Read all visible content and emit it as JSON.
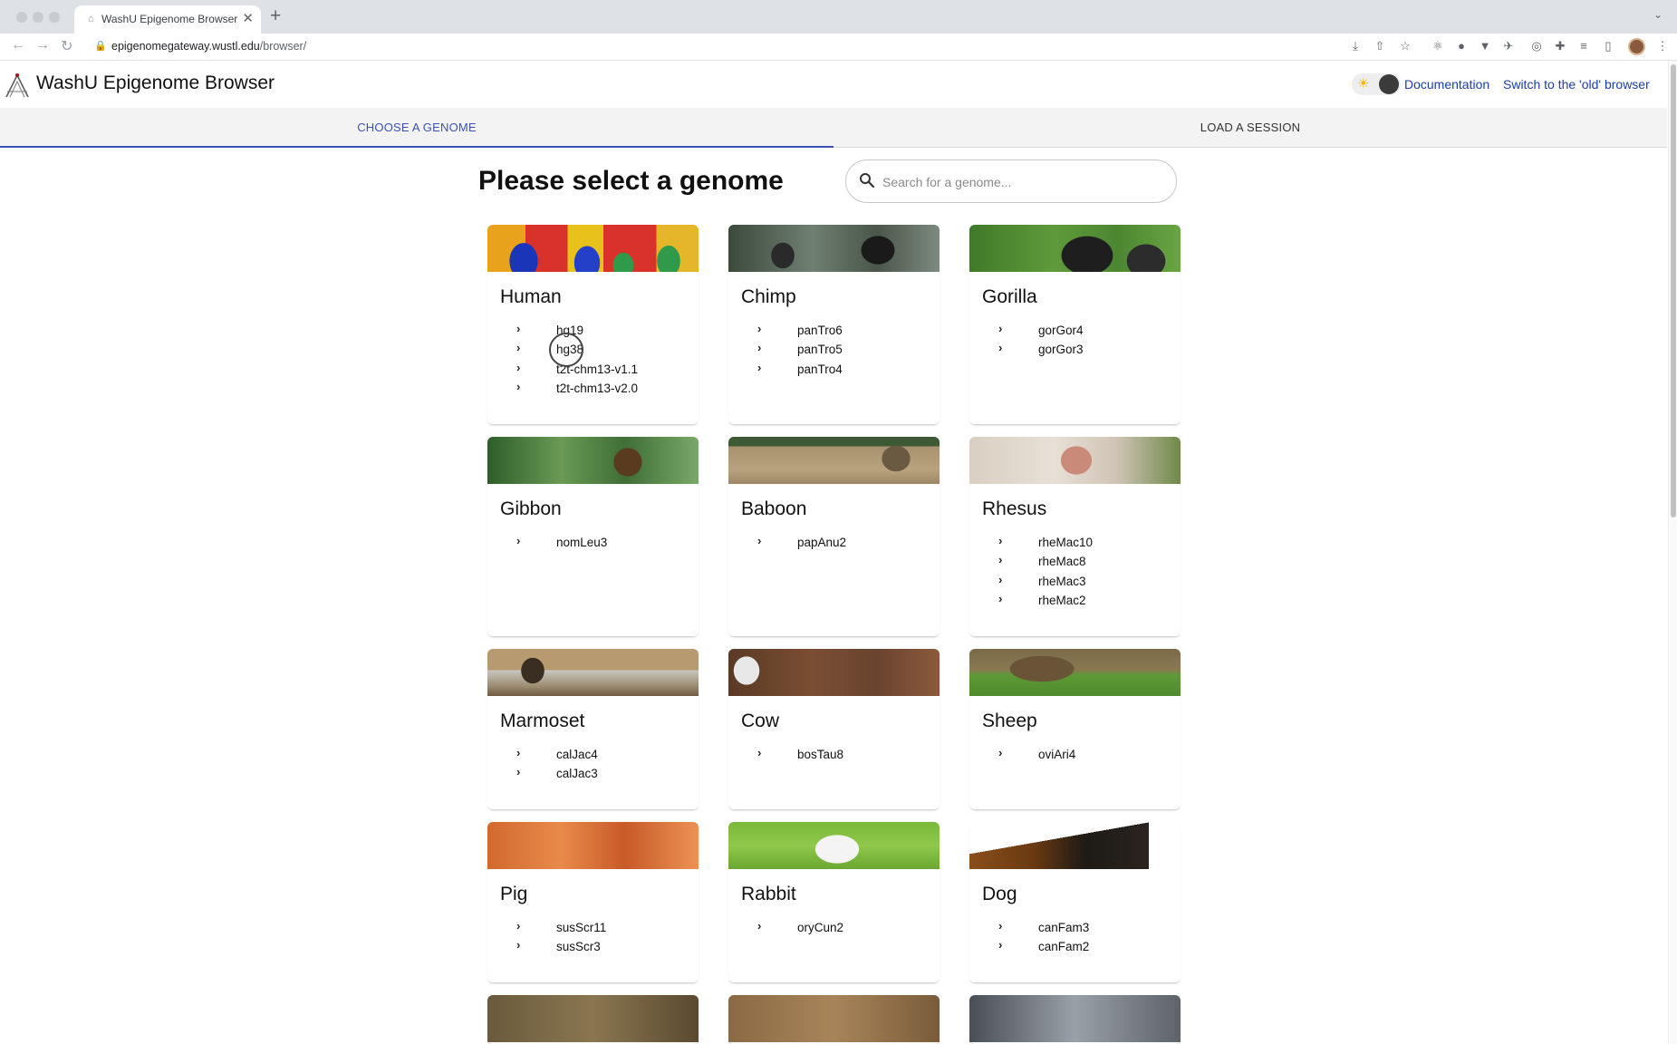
{
  "browser": {
    "tab_title": "WashU Epigenome Browser",
    "url_host": "epigenomegateway.wustl.edu",
    "url_path": "/browser/"
  },
  "app": {
    "title": "WashU Epigenome Browser",
    "documentation_link": "Documentation",
    "old_browser_link": "Switch to the 'old' browser"
  },
  "tabs": {
    "choose_genome": "Choose a genome",
    "load_session": "Load a session"
  },
  "main": {
    "heading": "Please select a genome",
    "search_placeholder": "Search for a genome..."
  },
  "genomes": [
    {
      "name": "Human",
      "assemblies": [
        "hg19",
        "hg38",
        "t2t-chm13-v1.1",
        "t2t-chm13-v2.0"
      ]
    },
    {
      "name": "Chimp",
      "assemblies": [
        "panTro6",
        "panTro5",
        "panTro4"
      ]
    },
    {
      "name": "Gorilla",
      "assemblies": [
        "gorGor4",
        "gorGor3"
      ]
    },
    {
      "name": "Gibbon",
      "assemblies": [
        "nomLeu3"
      ]
    },
    {
      "name": "Baboon",
      "assemblies": [
        "papAnu2"
      ]
    },
    {
      "name": "Rhesus",
      "assemblies": [
        "rheMac10",
        "rheMac8",
        "rheMac3",
        "rheMac2"
      ]
    },
    {
      "name": "Marmoset",
      "assemblies": [
        "calJac4",
        "calJac3"
      ]
    },
    {
      "name": "Cow",
      "assemblies": [
        "bosTau8"
      ]
    },
    {
      "name": "Sheep",
      "assemblies": [
        "oviAri4"
      ]
    },
    {
      "name": "Pig",
      "assemblies": [
        "susScr11",
        "susScr3"
      ]
    },
    {
      "name": "Rabbit",
      "assemblies": [
        "oryCun2"
      ]
    },
    {
      "name": "Dog",
      "assemblies": [
        "canFam3",
        "canFam2"
      ]
    }
  ],
  "colors": {
    "accent": "#3f51b5",
    "link": "#1a3ea6"
  }
}
